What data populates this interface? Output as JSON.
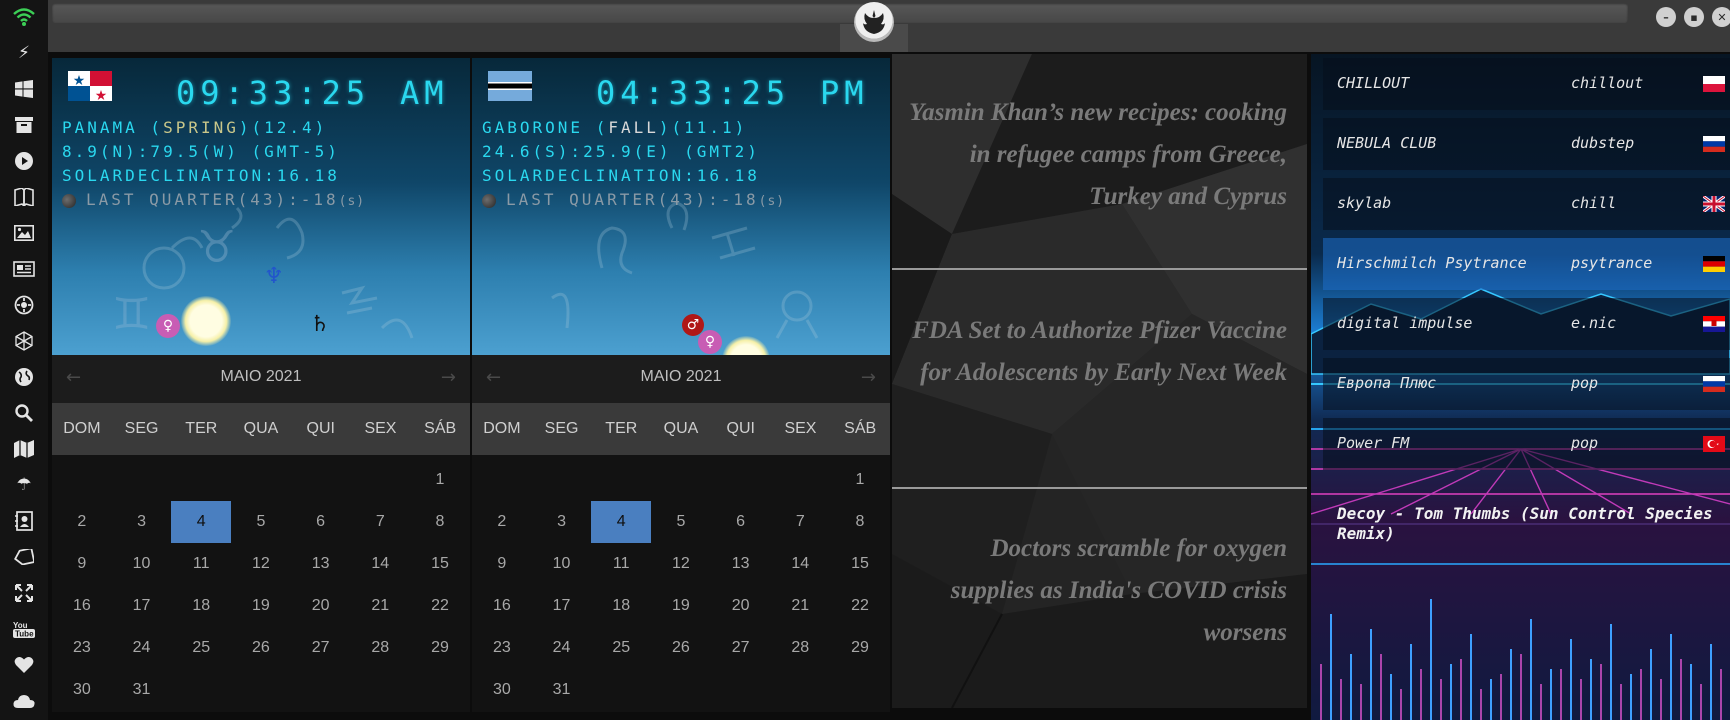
{
  "sidebar": {
    "icons": [
      "wifi-icon",
      "lightning-icon",
      "windows-icon",
      "archive-icon",
      "play-icon",
      "books-icon",
      "image-icon",
      "newspaper-icon",
      "gear-badge-icon",
      "network-icon",
      "globe-icon",
      "search-icon",
      "map-icon",
      "umbrella-icon",
      "contacts-icon",
      "tag-icon",
      "expand-icon",
      "youtube-icon",
      "heart-icon",
      "cloud-icon"
    ]
  },
  "titlebar": {
    "emblem": "rebel-alliance-icon",
    "buttons": [
      "minimize",
      "maximize",
      "close"
    ]
  },
  "clocks": [
    {
      "flag": "panama",
      "time": "09:33:25",
      "ampm": "AM",
      "location_prefix": "PANAMA (",
      "season": "SPRING",
      "location_suffix": ")(12.4)",
      "coords": "8.9(N):79.5(W) (GMT-5)",
      "declination": "SOLARDECLINATION:16.18",
      "moon": "LAST QUARTER(43):-18",
      "moon_unit": "(s)",
      "calendar": {
        "month": "MAIO 2021",
        "weekdays": [
          "DOM",
          "SEG",
          "TER",
          "QUA",
          "QUI",
          "SEX",
          "SÁB"
        ],
        "weeks": [
          [
            "",
            "",
            "",
            "",
            "",
            "",
            "1"
          ],
          [
            "2",
            "3",
            "4",
            "5",
            "6",
            "7",
            "8"
          ],
          [
            "9",
            "10",
            "11",
            "12",
            "13",
            "14",
            "15"
          ],
          [
            "16",
            "17",
            "18",
            "19",
            "20",
            "21",
            "22"
          ],
          [
            "23",
            "24",
            "25",
            "26",
            "27",
            "28",
            "29"
          ],
          [
            "30",
            "31",
            "",
            "",
            "",
            "",
            ""
          ]
        ],
        "selected": "4"
      }
    },
    {
      "flag": "botswana",
      "time": "04:33:25",
      "ampm": "PM",
      "location_prefix": "GABORONE (",
      "season": "FALL",
      "location_suffix": ")(11.1)",
      "coords": "24.6(S):25.9(E) (GMT2)",
      "declination": "SOLARDECLINATION:16.18",
      "moon": "LAST QUARTER(43):-18",
      "moon_unit": "(s)",
      "calendar": {
        "month": "MAIO 2021",
        "weekdays": [
          "DOM",
          "SEG",
          "TER",
          "QUA",
          "QUI",
          "SEX",
          "SÁB"
        ],
        "weeks": [
          [
            "",
            "",
            "",
            "",
            "",
            "",
            "1"
          ],
          [
            "2",
            "3",
            "4",
            "5",
            "6",
            "7",
            "8"
          ],
          [
            "9",
            "10",
            "11",
            "12",
            "13",
            "14",
            "15"
          ],
          [
            "16",
            "17",
            "18",
            "19",
            "20",
            "21",
            "22"
          ],
          [
            "23",
            "24",
            "25",
            "26",
            "27",
            "28",
            "29"
          ],
          [
            "30",
            "31",
            "",
            "",
            "",
            "",
            ""
          ]
        ],
        "selected": "4"
      }
    }
  ],
  "news": {
    "headlines": [
      "Yasmin Khan’s new recipes: cooking in refugee camps from Greece, Turkey and Cyprus",
      "FDA Set to Authorize Pfizer Vaccine for Adolescents by Early Next Week",
      "Doctors scramble for oxygen supplies as India's COVID crisis worsens"
    ]
  },
  "radio": {
    "stations": [
      {
        "name": "CHILLOUT",
        "genre": "chillout",
        "flag": "poland"
      },
      {
        "name": "NEBULA CLUB",
        "genre": "dubstep",
        "flag": "russia"
      },
      {
        "name": "skylab",
        "genre": "chill",
        "flag": "uk"
      },
      {
        "name": "Hirschmilch Psytrance",
        "genre": "psytrance",
        "flag": "germany"
      },
      {
        "name": "digital impulse",
        "genre": "e.nic",
        "flag": "croatia"
      },
      {
        "name": "Европа Плюс",
        "genre": "pop",
        "flag": "russia"
      },
      {
        "name": "Power FM",
        "genre": "pop",
        "flag": "turkey"
      }
    ],
    "active_index": 3,
    "now_playing": "Decoy - Tom Thumbs (Sun Control Species Remix)"
  },
  "colors": {
    "accent": "#2ad8ef",
    "selected_day": "#4a7fc0",
    "season_highlight": "#c9c78a"
  }
}
